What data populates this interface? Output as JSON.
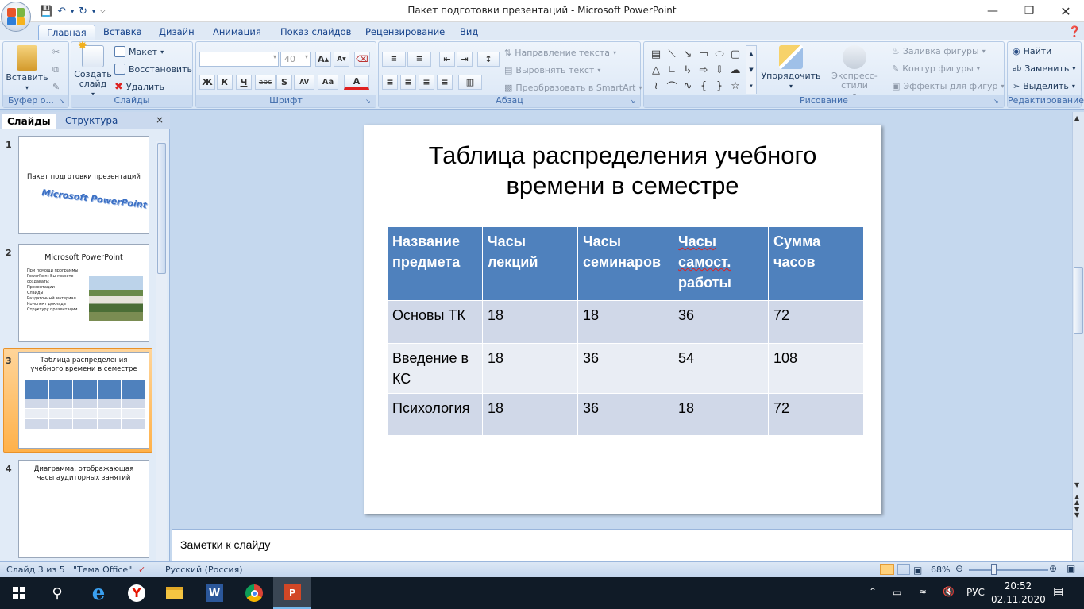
{
  "window": {
    "title": "Пакет подготовки презентаций - Microsoft PowerPoint"
  },
  "ribbon_tabs": [
    "Главная",
    "Вставка",
    "Дизайн",
    "Анимация",
    "Показ слайдов",
    "Рецензирование",
    "Вид"
  ],
  "ribbon": {
    "clipboard": {
      "label": "Буфер о...",
      "paste": "Вставить"
    },
    "slides": {
      "label": "Слайды",
      "new_slide": "Создать слайд",
      "layout": "Макет",
      "reset": "Восстановить",
      "delete": "Удалить"
    },
    "font": {
      "label": "Шрифт",
      "size": "40"
    },
    "paragraph": {
      "label": "Абзац",
      "text_direction": "Направление текста",
      "align_text": "Выровнять текст",
      "smartart": "Преобразовать в SmartArt"
    },
    "drawing": {
      "label": "Рисование",
      "arrange": "Упорядочить",
      "quick_styles": "Экспресс-стили",
      "fill": "Заливка фигуры",
      "outline": "Контур фигуры",
      "effects": "Эффекты для фигур"
    },
    "editing": {
      "label": "Редактирование",
      "find": "Найти",
      "replace": "Заменить",
      "select": "Выделить"
    }
  },
  "panel": {
    "tab_slides": "Слайды",
    "tab_outline": "Структура"
  },
  "thumbnails": [
    {
      "num": "1",
      "title": "Пакет подготовки презентаций",
      "wordart": "Microsoft PowerPoint"
    },
    {
      "num": "2",
      "title": "Microsoft PowerPoint",
      "body": [
        "При помощи программы PowerPoint Вы можете создавать:",
        "Презентации",
        "Слайды",
        "Раздаточный материал",
        "Конспект доклада",
        "Структуру презентации"
      ]
    },
    {
      "num": "3",
      "title": "Таблица распределения учебного времени в семестре"
    },
    {
      "num": "4",
      "title": "Диаграмма, отображающая часы аудиторных занятий"
    }
  ],
  "slide": {
    "title": "Таблица распределения учебного времени в семестре",
    "table": {
      "headers": [
        "Название предмета",
        "Часы лекций",
        "Часы семинаров",
        "Часы самост. работы",
        "Сумма часов"
      ],
      "rows": [
        [
          "Основы ТК",
          "18",
          "18",
          "36",
          "72"
        ],
        [
          "Введение в КС",
          "18",
          "36",
          "54",
          "108"
        ],
        [
          "Психология",
          "18",
          "36",
          "18",
          "72"
        ]
      ]
    }
  },
  "notes_placeholder": "Заметки к слайду",
  "status": {
    "slide": "Слайд 3 из 5",
    "theme": "\"Тема Office\"",
    "language": "Русский (Россия)",
    "zoom": "68%"
  },
  "tray": {
    "lang": "РУС",
    "time": "20:52",
    "date": "02.11.2020"
  }
}
